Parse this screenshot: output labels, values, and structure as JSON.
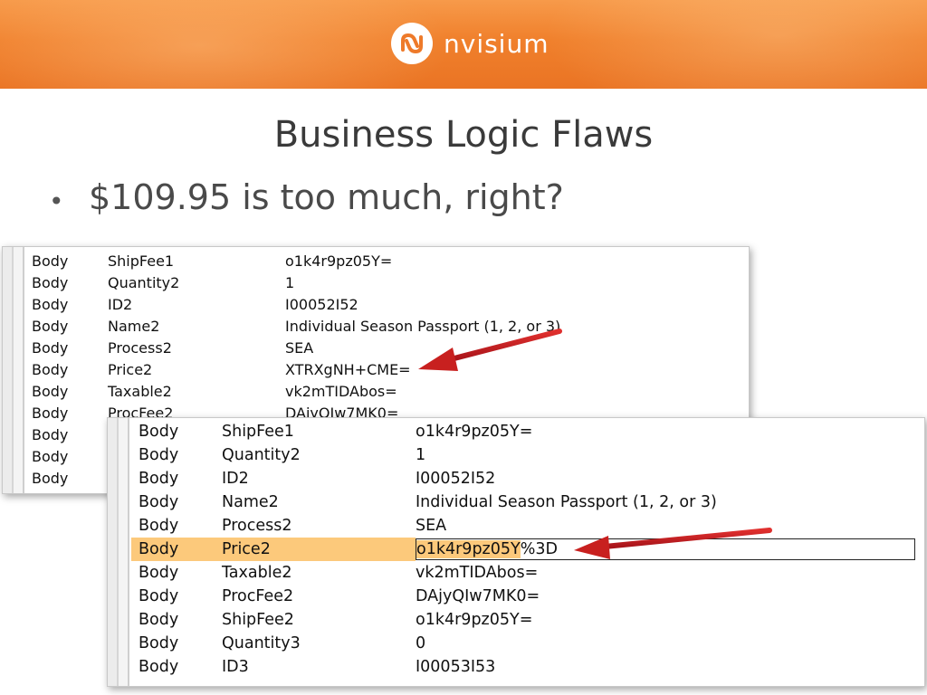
{
  "brand": {
    "name": "nvisium",
    "colors": {
      "banner": "#f0802c",
      "highlight": "#fcc97b",
      "arrow": "#c8201f"
    },
    "icon": "nvisium-logo-icon"
  },
  "slide": {
    "title": "Business Logic Flaws",
    "bullet": "$109.95 is too much, right?"
  },
  "table_back": {
    "rows": [
      {
        "type": "Body",
        "name": "ShipFee1",
        "value": "o1k4r9pz05Y="
      },
      {
        "type": "Body",
        "name": "Quantity2",
        "value": "1"
      },
      {
        "type": "Body",
        "name": "ID2",
        "value": "I00052I52"
      },
      {
        "type": "Body",
        "name": "Name2",
        "value": "Individual Season Passport (1, 2, or 3)"
      },
      {
        "type": "Body",
        "name": "Process2",
        "value": "SEA"
      },
      {
        "type": "Body",
        "name": "Price2",
        "value": "XTRXgNH+CME="
      },
      {
        "type": "Body",
        "name": "Taxable2",
        "value": "vk2mTIDAbos="
      },
      {
        "type": "Body",
        "name": "ProcFee2",
        "value": "DAjyQIw7MK0="
      },
      {
        "type": "Body",
        "name": "",
        "value": ""
      },
      {
        "type": "Body",
        "name": "",
        "value": ""
      },
      {
        "type": "Body",
        "name": "",
        "value": ""
      }
    ]
  },
  "table_front": {
    "rows": [
      {
        "type": "Body",
        "name": "ShipFee1",
        "value": "o1k4r9pz05Y="
      },
      {
        "type": "Body",
        "name": "Quantity2",
        "value": "1"
      },
      {
        "type": "Body",
        "name": "ID2",
        "value": "I00052I52"
      },
      {
        "type": "Body",
        "name": "Name2",
        "value": "Individual Season Passport (1, 2, or 3)"
      },
      {
        "type": "Body",
        "name": "Process2",
        "value": "SEA"
      },
      {
        "type": "Body",
        "name": "Price2",
        "value_selected": "o1k4r9pz05Y",
        "value_rest": "%3D"
      },
      {
        "type": "Body",
        "name": "Taxable2",
        "value": "vk2mTIDAbos="
      },
      {
        "type": "Body",
        "name": "ProcFee2",
        "value": "DAjyQIw7MK0="
      },
      {
        "type": "Body",
        "name": "ShipFee2",
        "value": "o1k4r9pz05Y="
      },
      {
        "type": "Body",
        "name": "Quantity3",
        "value": "0"
      },
      {
        "type": "Body",
        "name": "ID3",
        "value": "I00053I53"
      }
    ]
  }
}
